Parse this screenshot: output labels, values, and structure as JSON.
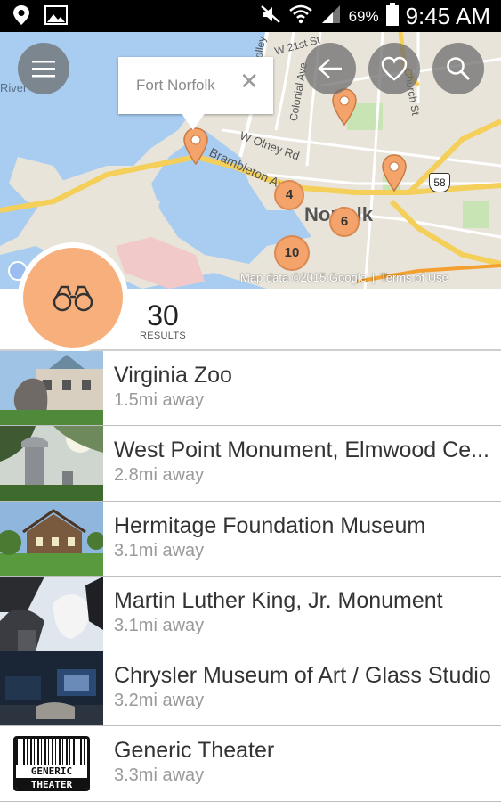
{
  "status_bar": {
    "battery": "69%",
    "time": "9:45 AM",
    "icons": [
      "location-icon",
      "image-icon",
      "mute-icon",
      "wifi-icon",
      "signal-icon",
      "battery-icon"
    ]
  },
  "map": {
    "callout_label": "Fort Norfolk",
    "callout_close": "✕",
    "labels": {
      "river": "River",
      "street_21st": "W 21st St",
      "colonial": "Colonial Ave",
      "w_olney": "W Olney Rd",
      "brambleton": "Brambleton Av",
      "norfolk": "Norfolk",
      "church": "Church St",
      "route": "58",
      "olley": "olley"
    },
    "clusters": [
      "4",
      "6",
      "10"
    ],
    "attribution": "Map data ©2015 Google",
    "terms": "Terms of Use",
    "accent": "#f4a36a"
  },
  "results": {
    "count": "30",
    "label": "RESULTS"
  },
  "places": [
    {
      "name": "Virginia Zoo",
      "distance": "1.5mi away"
    },
    {
      "name": "West Point Monument, Elmwood Ce...",
      "distance": "2.8mi away"
    },
    {
      "name": "Hermitage Foundation Museum",
      "distance": "3.1mi away"
    },
    {
      "name": "Martin Luther King, Jr. Monument",
      "distance": "3.1mi away"
    },
    {
      "name": "Chrysler Museum of Art / Glass Studio",
      "distance": "3.2mi away"
    },
    {
      "name": "Generic Theater",
      "distance": "3.3mi away"
    }
  ],
  "theater_logo": {
    "line1": "GENERIC",
    "line2": "THEATER"
  }
}
